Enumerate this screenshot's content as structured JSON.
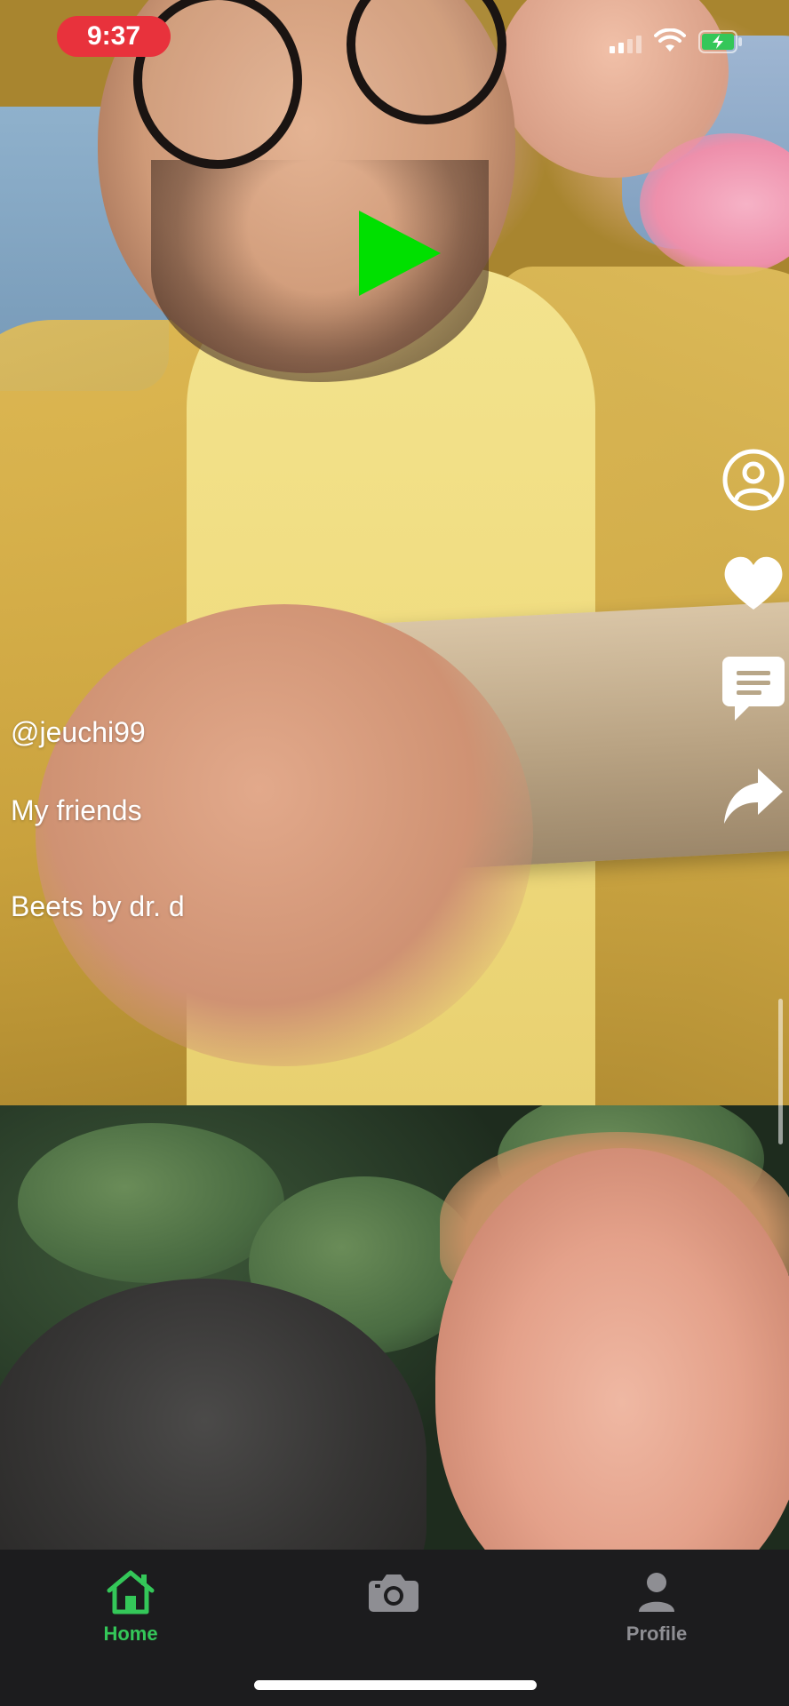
{
  "status_bar": {
    "time": "9:37",
    "time_pill_color": "#e8323c",
    "signal_icon": "cellular-signal-icon",
    "wifi_icon": "wifi-icon",
    "battery_icon": "battery-charging-icon",
    "battery_color": "#34c759"
  },
  "player": {
    "play_icon": "play-icon",
    "play_color": "#00e000"
  },
  "actions": [
    {
      "name": "profile",
      "icon": "user-circle-icon"
    },
    {
      "name": "like",
      "icon": "heart-icon"
    },
    {
      "name": "comment",
      "icon": "comment-icon"
    },
    {
      "name": "share",
      "icon": "share-icon"
    }
  ],
  "caption": {
    "username": "@jeuchi99",
    "title": "My friends",
    "song": "Beets by dr. d"
  },
  "tab_bar": {
    "active_color": "#34c759",
    "inactive_color": "#8e8e93",
    "tabs": [
      {
        "label": "Home",
        "icon": "home-icon",
        "active": true
      },
      {
        "label": "",
        "icon": "camera-icon",
        "active": false
      },
      {
        "label": "Profile",
        "icon": "person-icon",
        "active": false
      }
    ]
  }
}
